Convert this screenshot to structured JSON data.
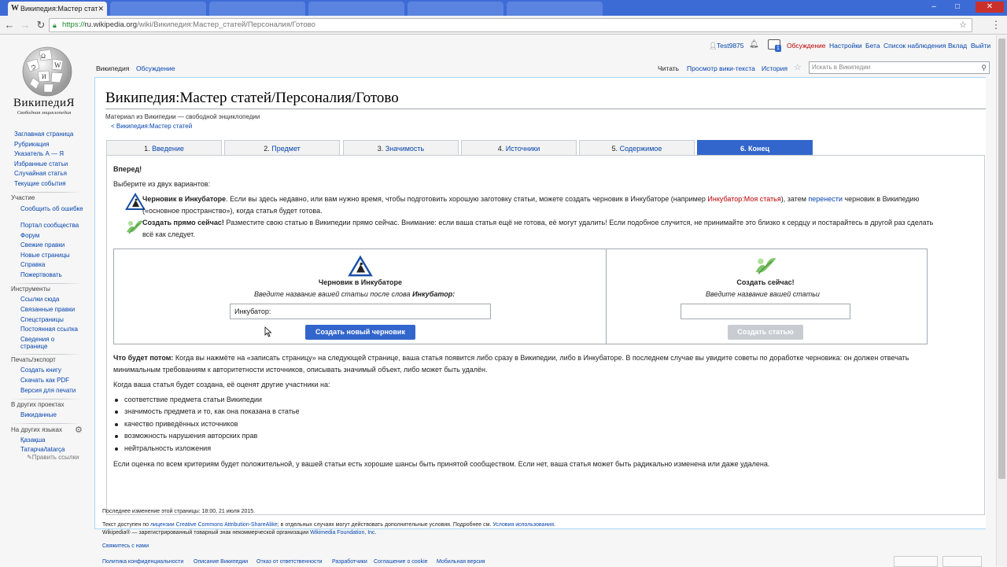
{
  "browser": {
    "tabs": [
      {
        "title": "Википедия:Мастер стат",
        "active": true
      },
      {
        "title": "",
        "active": false
      },
      {
        "title": "",
        "active": false
      },
      {
        "title": "",
        "active": false
      },
      {
        "title": "",
        "active": false
      },
      {
        "title": "",
        "active": false
      }
    ],
    "url_scheme": "https://",
    "url_host": "ru.wikipedia.org",
    "url_path": "/wiki/Википедия:Мастер_статей/Персоналия/Готово"
  },
  "sidebar": {
    "wordmark": "ВикипедиЯ",
    "tagline": "Свободная энциклопедия",
    "nav": [
      "Заглавная страница",
      "Рубрикация",
      "Указатель А — Я",
      "Избранные статьи",
      "Случайная статья",
      "Текущие события"
    ],
    "participation_heading": "Участие",
    "participation": [
      "Сообщить об ошибке",
      "Портал сообщества",
      "Форум",
      "Свежие правки",
      "Новые страницы",
      "Справка",
      "Пожертвовать"
    ],
    "tools_heading": "Инструменты",
    "tools": [
      "Ссылки сюда",
      "Связанные правки",
      "Спецстраницы",
      "Постоянная ссылка",
      "Сведения о странице"
    ],
    "print_heading": "Печать/экспорт",
    "print": [
      "Создать книгу",
      "Скачать как PDF",
      "Версия для печати"
    ],
    "projects_heading": "В других проектах",
    "projects": [
      "Викиданные"
    ],
    "languages_heading": "На других языках",
    "languages": [
      "Қазақша",
      "Татарча/tatarça"
    ],
    "edit_links": "Править ссылки"
  },
  "personal": {
    "username": "Test9875",
    "notification_count": "1",
    "talk": "Обсуждение",
    "preferences": "Настройки",
    "beta": "Бета",
    "watchlist": "Список наблюдения",
    "contributions": "Вклад",
    "logout": "Выйти"
  },
  "page_tabs": {
    "project": "Википедия",
    "discussion": "Обсуждение",
    "read": "Читать",
    "view_source": "Просмотр вики-текста",
    "history": "История",
    "search_placeholder": "Искать в Википедии"
  },
  "article": {
    "title": "Википедия:Мастер статей/Персоналия/Готово",
    "site_sub": "Материал из Википедии — свободной энциклопедии",
    "backlink": "< Википедия:Мастер статей",
    "wizard_tabs": [
      {
        "num": "1.",
        "label": "Введение"
      },
      {
        "num": "2.",
        "label": "Предмет"
      },
      {
        "num": "3.",
        "label": "Значимость"
      },
      {
        "num": "4.",
        "label": "Источники"
      },
      {
        "num": "5.",
        "label": "Содержимое"
      },
      {
        "num": "6.",
        "label": "Конец"
      }
    ],
    "forward": "Вперед!",
    "choose": "Выберите из двух вариантов:",
    "opt1_title": "Черновик в Инкубаторе",
    "opt1_text_a": ". Если вы здесь недавно, или вам нужно время, чтобы подготовить хорошую заготовку статьи, можете создать черновик в Инкубаторе (например ",
    "opt1_link1": "Инкубатор:Моя статья",
    "opt1_text_b": "), затем ",
    "opt1_link2": "перенести",
    "opt1_text_c": " черновик в Википедию",
    "opt1_line2": "(«основное пространство»), когда статья будет готова.",
    "opt2_title": "Создать прямо сейчас!",
    "opt2_text": " Разместите свою статью в Википедии прямо сейчас. Внимание: если ваша статья ещё не готова, её могут удалить! Если подобное случится, не принимайте это близко к сердцу и постарайтесь в другой раз сделать",
    "opt2_line2": "всё как следует.",
    "left_box": {
      "title": "Черновик в Инкубаторе",
      "hint": "Введите название вашей статьи после слова ",
      "hint_bold": "Инкубатор:",
      "input_value": "Инкубатор:",
      "button": "Создать новый черновик"
    },
    "right_box": {
      "title": "Создать сейчас!",
      "hint": "Введите название вашей статьи",
      "input_value": "",
      "button": "Создать статью"
    },
    "next_label": "Что будет потом:",
    "next_text": " Когда вы нажмёте на «записать страницу» на следующей странице, ваша статья появится либо сразу в Википедии, либо в Инкубаторе. В последнем случае вы увидите советы по доработке черновика: он должен отвечать",
    "next_line2": "минимальным требованиям к авторитетности источников, описывать значимый объект, либо может быть удалён.",
    "evaluate": "Когда ваша статья будет создана, её оценят другие участники на:",
    "criteria": [
      "соответствие предмета статьи Википедии",
      "значимость предмета и то, как она показана в статье",
      "качество приведённых источников",
      "возможность нарушения авторских прав",
      "нейтральность изложения"
    ],
    "conclusion": "Если оценка по всем критериям будет положительной, у вашей статьи есть хорошие шансы быть принятой сообществом. Если нет, ваша статья может быть радикально изменена или даже удалена."
  },
  "footer": {
    "lastmod": "Последнее изменение этой страницы: 18:00, 21 июля 2015.",
    "license_a": "Текст доступен по ",
    "license_link": "лицензии Creative Commons Attribution-ShareAlike",
    "license_b": "; в отдельных случаях могут действовать дополнительные условия. Подробнее см. ",
    "terms_link": "Условия использования",
    "trademark_a": "Wikipedia® — зарегистрированный товарный знак некоммерческой организации ",
    "trademark_link": "Wikimedia Foundation, Inc.",
    "contact": "Свяжитесь с нами",
    "links": [
      "Политика конфиденциальности",
      "Описание Википедии",
      "Отказ от ответственности",
      "Разработчики",
      "Соглашение о cookie",
      "Мобильная версия"
    ]
  },
  "colors": {
    "accent": "#3366cc",
    "link": "#0645ad",
    "redlink": "#ba0000",
    "tabstrip": "#3d6bd6"
  }
}
